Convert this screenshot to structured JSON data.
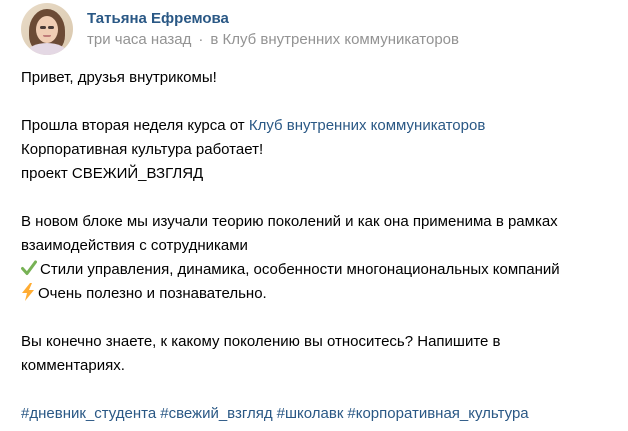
{
  "post": {
    "author": "Татьяна Ефремова",
    "time": "три часа назад",
    "separator": "·",
    "club_prefix": "в",
    "club_link": "Клуб внутренних коммуникаторов",
    "text": {
      "greeting": "Привет, друзья внутрикомы!",
      "para2_prefix": "Прошла вторая неделя курса от ",
      "para2_link": "Клуб внутренних коммуникаторов",
      "para2_line2": "Корпоративная культура работает!",
      "para2_line3": "проект СВЕЖИЙ_ВЗГЛЯД",
      "para3_line1": "В новом блоке мы изучали теорию поколений и как она применима в рамках",
      "para3_line2": "взаимодействия с сотрудниками",
      "check_item": "Стили управления, динамика, особенности многонациональных компаний",
      "bolt_item": "Очень полезно и познавательно.",
      "question_line1": "Вы конечно знаете, к какому поколению вы относитесь? Напишите в",
      "question_line2": "комментариях."
    },
    "hashtags": [
      "#дневник_студента",
      "#свежий_взгляд",
      "#школавк",
      "#корпоративная_культура"
    ],
    "icons": {
      "check": "check-mark-icon",
      "bolt": "lightning-icon"
    },
    "colors": {
      "link": "#2a5885",
      "meta": "#939393",
      "check": "#77b255",
      "bolt": "#ffac33"
    }
  }
}
